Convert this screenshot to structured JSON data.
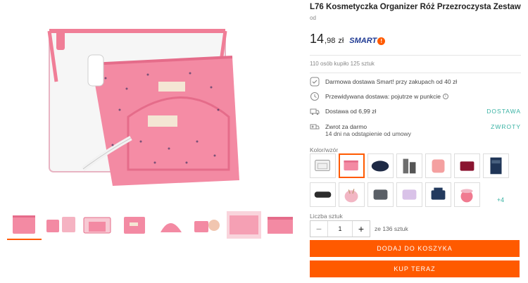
{
  "product": {
    "title": "L76 Kosmetyczka Organizer Róż Przezroczysta Zestaw",
    "price_prefix": "od",
    "price_main": "14",
    "price_fraction": ",98",
    "currency": "zł",
    "smart_label": "SMART",
    "smart_badge": "!",
    "buyers_text": "110 osób kupiło 125 sztuk"
  },
  "delivery": {
    "free_smart": "Darmowa dostawa Smart! przy zakupach od 40 zł",
    "expected": "Przewidywana dostawa: pojutrze w punkcie",
    "info_symbol": "i",
    "cost_text": "Dostawa od 6,99 zł",
    "cost_link": "DOSTAWA",
    "returns_title": "Zwrot za darmo",
    "returns_sub": "14 dni na odstąpienie od umowy",
    "returns_link": "ZWROTY"
  },
  "variants": {
    "label": "Kolor/wzór",
    "more_label": "+4",
    "items": [
      {
        "name": "clear-set",
        "color": "#d9d9d9"
      },
      {
        "name": "pink-set",
        "color": "#f08aa6"
      },
      {
        "name": "navy-pouch",
        "color": "#1e2a45"
      },
      {
        "name": "grey-organizer",
        "color": "#6d6d6d"
      },
      {
        "name": "peach-pouch",
        "color": "#f4a0a0"
      },
      {
        "name": "burgundy-case",
        "color": "#8a1430"
      },
      {
        "name": "navy-hanging",
        "color": "#1f3557"
      },
      {
        "name": "black-roll",
        "color": "#2b2b2b"
      },
      {
        "name": "pink-cylinder",
        "color": "#f2b6c4"
      },
      {
        "name": "grey-pouch",
        "color": "#5a5f66"
      },
      {
        "name": "lilac-pouch",
        "color": "#d9c2e8"
      },
      {
        "name": "navy-set",
        "color": "#233a5e"
      },
      {
        "name": "pink-bucket",
        "color": "#f07a90"
      }
    ]
  },
  "quantity": {
    "label": "Liczba sztuk",
    "value": "1",
    "minus": "−",
    "plus": "+",
    "stock_text": "ze 136 sztuk"
  },
  "actions": {
    "add_to_cart": "DODAJ DO KOSZYKA",
    "buy_now": "KUP TERAZ"
  },
  "colors": {
    "accent": "#ff5a00",
    "teal": "#38b2a3",
    "pink": "#f07e97",
    "smart_blue": "#1f3a93"
  },
  "main_image_labels": {
    "tag_small": "Natural Style",
    "tag_brand": "HANDMADE"
  }
}
